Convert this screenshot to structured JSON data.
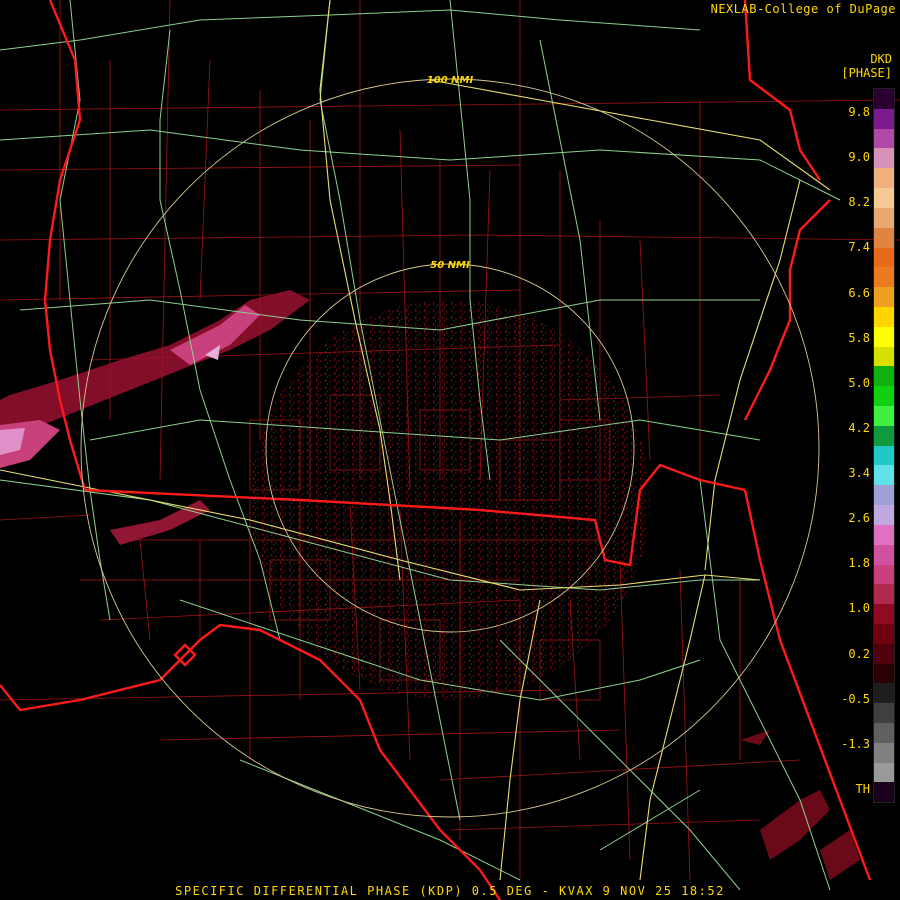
{
  "header": {
    "credit": "NEXLAB-College of DuPage",
    "product_code": "DKD",
    "product_units": "[PHASE]"
  },
  "range_rings": {
    "inner_label": "50 NMI",
    "outer_label": "100 NMI"
  },
  "caption": "SPECIFIC DIFFERENTIAL PHASE (KDP) 0.5 DEG - KVAX 9 NOV 25 18:52",
  "legend": {
    "ticks": [
      "9.8",
      "9.0",
      "8.2",
      "7.4",
      "6.6",
      "5.8",
      "5.0",
      "4.2",
      "3.4",
      "2.6",
      "1.8",
      "1.0",
      "0.2",
      "-0.5",
      "-1.3",
      "TH"
    ],
    "colors": [
      "#2a0030",
      "#7a1a8c",
      "#b04aa8",
      "#d790b8",
      "#f0b080",
      "#f5c894",
      "#e8a870",
      "#e08440",
      "#e86a1a",
      "#ec7a20",
      "#f0a020",
      "#ffd400",
      "#ffff00",
      "#d8e000",
      "#10b010",
      "#10d010",
      "#40f040",
      "#109a40",
      "#20c8c8",
      "#60e0e8",
      "#a0a0d8",
      "#c0a8e0",
      "#e070c0",
      "#d050a0",
      "#c8407c",
      "#b02a50",
      "#900a22",
      "#700010",
      "#50000a",
      "#2a0006",
      "#1e1e1e",
      "#404040",
      "#606060",
      "#808080",
      "#9a9a9a",
      "#1a001a"
    ]
  },
  "colors": {
    "state_line": "#ff1a1a",
    "county_line": "#a01414",
    "highway": "#8fd08f",
    "interstate": "#e8e070",
    "ring": "#d8c890",
    "text": "#ffd800"
  }
}
